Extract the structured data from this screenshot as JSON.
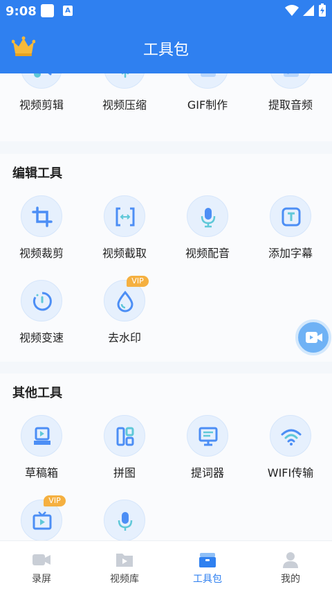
{
  "status_bar": {
    "time": "9:08",
    "notification_letter": "A"
  },
  "header": {
    "title": "工具包"
  },
  "top_tools": [
    {
      "label": "视频剪辑",
      "icon": "scissors-icon"
    },
    {
      "label": "视频压缩",
      "icon": "compress-icon"
    },
    {
      "label": "GIF制作",
      "icon": "gif-icon"
    },
    {
      "label": "提取音频",
      "icon": "music-note-icon"
    }
  ],
  "edit_section": {
    "title": "编辑工具",
    "tools": [
      {
        "label": "视频裁剪",
        "icon": "crop-icon"
      },
      {
        "label": "视频截取",
        "icon": "trim-icon"
      },
      {
        "label": "视频配音",
        "icon": "microphone-icon"
      },
      {
        "label": "添加字幕",
        "icon": "subtitle-icon"
      },
      {
        "label": "视频变速",
        "icon": "speed-icon"
      },
      {
        "label": "去水印",
        "icon": "watermark-drop-icon",
        "badge": "VIP"
      }
    ]
  },
  "other_section": {
    "title": "其他工具",
    "tools": [
      {
        "label": "草稿箱",
        "icon": "drafts-icon"
      },
      {
        "label": "拼图",
        "icon": "collage-icon"
      },
      {
        "label": "提词器",
        "icon": "teleprompter-icon"
      },
      {
        "label": "WIFI传输",
        "icon": "wifi-icon"
      },
      {
        "label": "",
        "icon": "tv-icon",
        "badge": "VIP"
      },
      {
        "label": "",
        "icon": "microphone-icon"
      }
    ]
  },
  "tabbar": {
    "tabs": [
      {
        "label": "录屏",
        "icon": "video-camera-icon"
      },
      {
        "label": "视频库",
        "icon": "folder-play-icon"
      },
      {
        "label": "工具包",
        "icon": "toolbox-icon",
        "active": true
      },
      {
        "label": "我的",
        "icon": "user-icon"
      }
    ]
  },
  "colors": {
    "primary": "#2f80f0",
    "icon_bg": "#e6f0fd",
    "vip": "#f5b040"
  }
}
